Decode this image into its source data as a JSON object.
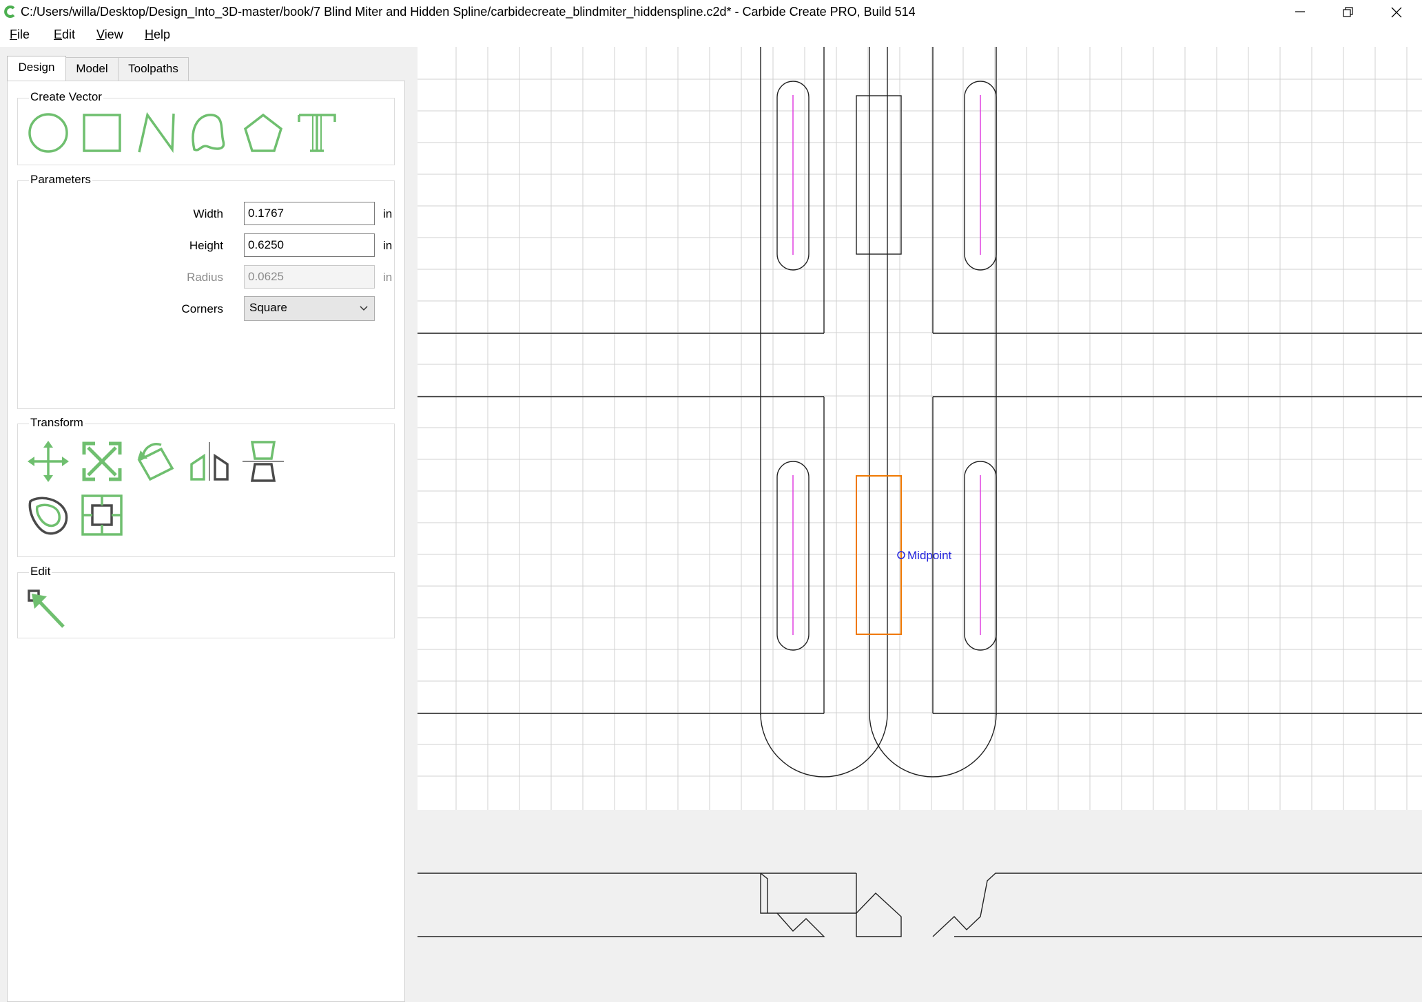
{
  "window": {
    "title": "C:/Users/willa/Desktop/Design_Into_3D-master/book/7 Blind Miter and Hidden Spline/carbidecreate_blindmiter_hiddenspline.c2d* - Carbide Create PRO, Build 514"
  },
  "menu": {
    "items": [
      {
        "first": "F",
        "rest": "ile"
      },
      {
        "first": "E",
        "rest": "dit"
      },
      {
        "first": "V",
        "rest": "iew"
      },
      {
        "first": "H",
        "rest": "elp"
      }
    ]
  },
  "tabs": [
    "Design",
    "Model",
    "Toolpaths"
  ],
  "create_vector": {
    "label": "Create Vector",
    "tools": [
      "circle-icon",
      "rectangle-icon",
      "polyline-icon",
      "curve-icon",
      "polygon-icon",
      "text-icon"
    ]
  },
  "parameters": {
    "label": "Parameters",
    "width": {
      "label": "Width",
      "value": "0.1767",
      "unit": "in"
    },
    "height": {
      "label": "Height",
      "value": "0.6250",
      "unit": "in"
    },
    "radius": {
      "label": "Radius",
      "value": "0.0625",
      "unit": "in"
    },
    "corners": {
      "label": "Corners",
      "value": "Square"
    }
  },
  "transform": {
    "label": "Transform",
    "tools": [
      "move-icon",
      "scale-icon",
      "rotate-icon",
      "mirror-icon",
      "align-icon",
      "offset-icon",
      "boundary-icon"
    ]
  },
  "edit": {
    "label": "Edit",
    "tools": [
      "node-edit-icon"
    ]
  },
  "canvas": {
    "snap_label": "Midpoint",
    "colors": {
      "grid": "#d0d0d0",
      "vector": "#222222",
      "selected": "#f07800",
      "toolpath": "#e040e0",
      "snap": "#2222dd",
      "tool_green": "#6fbf6f"
    }
  }
}
